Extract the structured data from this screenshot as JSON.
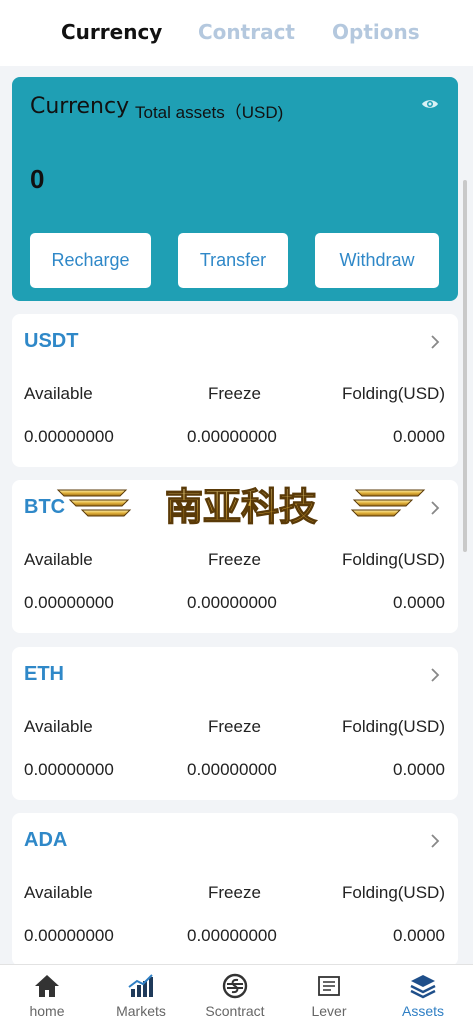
{
  "tabs": [
    "Currency",
    "Contract",
    "Options"
  ],
  "summary": {
    "title": "Currency",
    "subtitle": "Total assets（USD)",
    "amount": "0",
    "buttons": [
      "Recharge",
      "Transfer",
      "Withdraw"
    ]
  },
  "labels": {
    "available": "Available",
    "freeze": "Freeze",
    "folding": "Folding(USD)"
  },
  "assets": [
    {
      "coin": "USDT",
      "available": "0.00000000",
      "freeze": "0.00000000",
      "folding": "0.0000"
    },
    {
      "coin": "BTC",
      "available": "0.00000000",
      "freeze": "0.00000000",
      "folding": "0.0000"
    },
    {
      "coin": "ETH",
      "available": "0.00000000",
      "freeze": "0.00000000",
      "folding": "0.0000"
    },
    {
      "coin": "ADA",
      "available": "0.00000000",
      "freeze": "0.00000000",
      "folding": "0.0000"
    }
  ],
  "watermark": "南亚科技",
  "nav": [
    {
      "label": "home",
      "icon": "home-icon"
    },
    {
      "label": "Markets",
      "icon": "markets-chart-icon"
    },
    {
      "label": "Scontract",
      "icon": "scontract-icon"
    },
    {
      "label": "Lever",
      "icon": "lever-icon"
    },
    {
      "label": "Assets",
      "icon": "assets-layers-icon",
      "active": true
    }
  ],
  "colors": {
    "accent": "#1f9fb4",
    "link": "#2f88c8",
    "tab_inactive": "#b4c8de",
    "nav_active": "#2f7fc4"
  }
}
